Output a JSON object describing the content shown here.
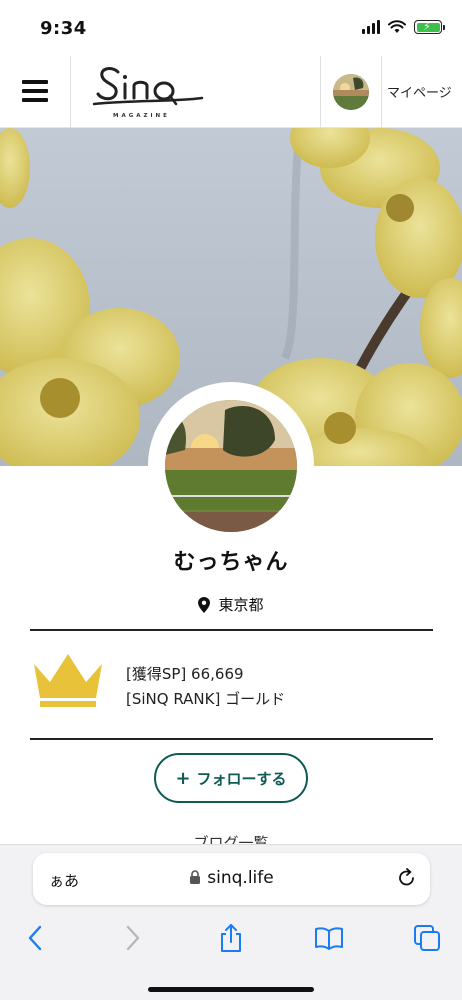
{
  "status_bar": {
    "time": "9:34"
  },
  "header": {
    "logo_text": "Sinq",
    "logo_sub": "MAGAZINE",
    "mypage_label": "マイページ"
  },
  "profile": {
    "name": "むっちゃん",
    "location": "東京都",
    "points_line": "[獲得SP]  66,669",
    "rank_line": "[SiNQ RANK]  ゴールド",
    "follow_label": "フォローする",
    "follow_plus": "+",
    "partial_section": "ブログ一覧"
  },
  "browser": {
    "aa_label": "ぁあ",
    "url": "sinq.life"
  },
  "colors": {
    "accent": "#0f5a55",
    "crown": "#e8c33a",
    "battery": "#3bc14a",
    "safari_blue": "#1a7cf5"
  },
  "icons": [
    "hamburger-icon",
    "location-pin-icon",
    "crown-icon",
    "plus-icon",
    "lock-icon",
    "reload-icon",
    "back-icon",
    "forward-icon",
    "share-icon",
    "bookmarks-icon",
    "tabs-icon"
  ]
}
